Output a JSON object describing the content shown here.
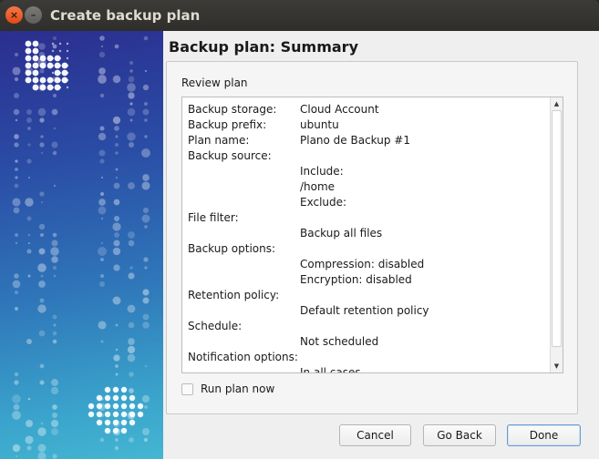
{
  "window": {
    "title": "Create backup plan",
    "close_glyph": "×",
    "minimize_glyph": "–"
  },
  "page": {
    "heading": "Backup plan: Summary",
    "panel_label": "Review plan"
  },
  "summary": {
    "rows": [
      {
        "key": "Backup storage:",
        "value": "Cloud Account"
      },
      {
        "key": "Backup prefix:",
        "value": "ubuntu"
      },
      {
        "key": "Plan name:",
        "value": "Plano de Backup #1"
      },
      {
        "key": "Backup source:",
        "value": ""
      },
      {
        "key": "",
        "value": "Include:"
      },
      {
        "key": "",
        "value": "/home"
      },
      {
        "key": "",
        "value": "Exclude:"
      },
      {
        "key": "File filter:",
        "value": ""
      },
      {
        "key": "",
        "value": "Backup all files"
      },
      {
        "key": "Backup options:",
        "value": ""
      },
      {
        "key": "",
        "value": "Compression: disabled"
      },
      {
        "key": "",
        "value": "Encryption: disabled"
      },
      {
        "key": "Retention policy:",
        "value": ""
      },
      {
        "key": "",
        "value": "Default retention policy"
      },
      {
        "key": "Schedule:",
        "value": ""
      },
      {
        "key": "",
        "value": "Not scheduled"
      },
      {
        "key": "Notification options:",
        "value": ""
      },
      {
        "key": "",
        "value": "In all cases"
      }
    ]
  },
  "options": {
    "run_now_label": "Run plan now",
    "run_now_checked": false
  },
  "buttons": {
    "cancel": "Cancel",
    "back": "Go Back",
    "done": "Done"
  },
  "colors": {
    "titlebar": "#3c3b37",
    "close_button": "#df4a16",
    "banner_top": "#2b2e8f",
    "banner_bottom": "#44b6d2",
    "default_button_border": "#6b9bd6"
  },
  "icons": {
    "scroll_up": "scroll-up-arrow-icon",
    "scroll_down": "scroll-down-arrow-icon",
    "logo": "dotted-logo-icon"
  }
}
